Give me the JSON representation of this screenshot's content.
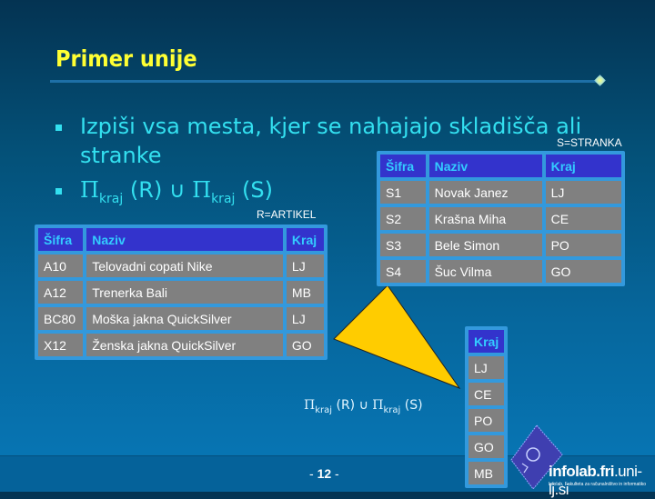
{
  "slide": {
    "title": "Primer unije",
    "page_number_prefix": "- ",
    "page_number": "12",
    "page_number_suffix": " -",
    "colors": {
      "title": "#ffff33",
      "bullet_text": "#33e0f0",
      "table_header_bg": "#3333cc",
      "table_header_text": "#33ccff",
      "table_cell_bg": "#808080",
      "table_border": "#3399dd",
      "arrow": "#ffcc00"
    }
  },
  "bullets": [
    {
      "text": "Izpiši vsa mesta, kjer se nahajajo skladišča ali stranke"
    },
    {
      "pi1": "Π",
      "sub1": "kraj",
      "mid": " (R) ∪ ",
      "pi2": "Π",
      "sub2": "kraj",
      "end": " (S)"
    }
  ],
  "relation_r": {
    "label": "R=ARTIKEL",
    "columns": [
      "Šifra",
      "Naziv",
      "Kraj"
    ],
    "rows": [
      [
        "A10",
        "Telovadni copati Nike",
        "LJ"
      ],
      [
        "A12",
        "Trenerka Bali",
        "MB"
      ],
      [
        "BC80",
        "Moška jakna QuickSilver",
        "LJ"
      ],
      [
        "X12",
        "Ženska jakna QuickSilver",
        "GO"
      ]
    ]
  },
  "relation_s": {
    "label": "S=STRANKA",
    "columns": [
      "Šifra",
      "Naziv",
      "Kraj"
    ],
    "rows": [
      [
        "S1",
        "Novak Janez",
        "LJ"
      ],
      [
        "S2",
        "Krašna Miha",
        "CE"
      ],
      [
        "S3",
        "Bele Simon",
        "PO"
      ],
      [
        "S4",
        "Šuc Vilma",
        "GO"
      ]
    ]
  },
  "result": {
    "columns": [
      "Kraj"
    ],
    "rows": [
      [
        "LJ"
      ],
      [
        "CE"
      ],
      [
        "PO"
      ],
      [
        "GO"
      ],
      [
        "MB"
      ]
    ],
    "formula": {
      "pi1": "Π",
      "sub1": "kraj",
      "mid": " (R) ∪ ",
      "pi2": "Π",
      "sub2": "kraj",
      "end": " (S)"
    }
  },
  "logo": {
    "name_part1": "infolab.",
    "name_part2": "fri",
    "name_part3": ".uni-lj.si",
    "tagline": "Infolab, Fakulteta za računalništvo in informatiko"
  }
}
